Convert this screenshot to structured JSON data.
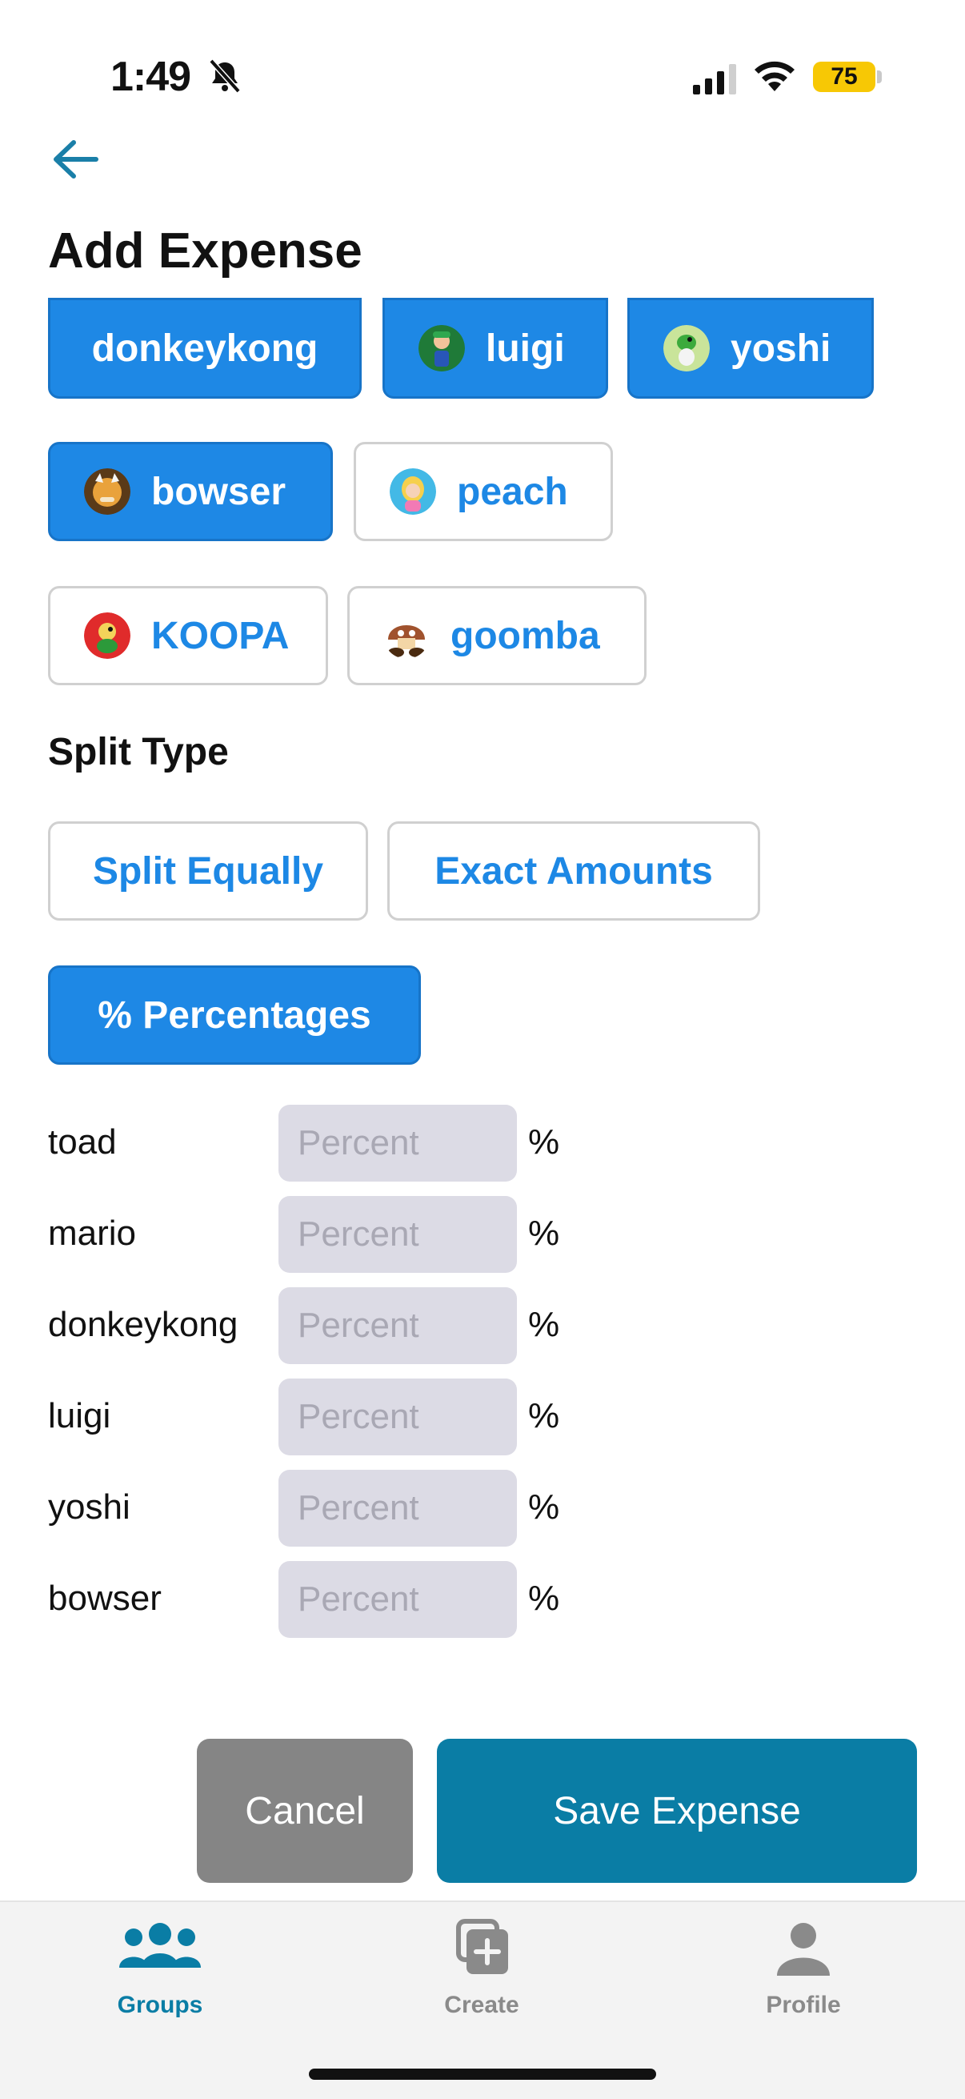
{
  "status_bar": {
    "time": "1:49",
    "battery": "75"
  },
  "header": {
    "title": "Add Expense"
  },
  "participants": [
    {
      "label": "donkeykong",
      "selected": true,
      "avatar": "none"
    },
    {
      "label": "luigi",
      "selected": true,
      "avatar": "luigi-avatar"
    },
    {
      "label": "yoshi",
      "selected": true,
      "avatar": "yoshi-avatar"
    },
    {
      "label": "bowser",
      "selected": true,
      "avatar": "bowser-avatar"
    },
    {
      "label": "peach",
      "selected": false,
      "avatar": "peach-avatar"
    },
    {
      "label": "KOOPA",
      "selected": false,
      "avatar": "koopa-avatar"
    },
    {
      "label": "goomba",
      "selected": false,
      "avatar": "goomba-avatar"
    }
  ],
  "split": {
    "title": "Split Type",
    "options": [
      {
        "label": "Split Equally",
        "selected": false
      },
      {
        "label": "Exact Amounts",
        "selected": false
      },
      {
        "label": "% Percentages",
        "selected": true
      }
    ],
    "rows": [
      {
        "name": "toad",
        "placeholder": "Percent",
        "value": "",
        "unit": "%"
      },
      {
        "name": "mario",
        "placeholder": "Percent",
        "value": "",
        "unit": "%"
      },
      {
        "name": "donkeykong",
        "placeholder": "Percent",
        "value": "",
        "unit": "%"
      },
      {
        "name": "luigi",
        "placeholder": "Percent",
        "value": "",
        "unit": "%"
      },
      {
        "name": "yoshi",
        "placeholder": "Percent",
        "value": "",
        "unit": "%"
      },
      {
        "name": "bowser",
        "placeholder": "Percent",
        "value": "",
        "unit": "%"
      }
    ]
  },
  "actions": {
    "cancel": "Cancel",
    "save": "Save Expense"
  },
  "tabbar": {
    "items": [
      {
        "label": "Groups",
        "icon": "groups-icon",
        "active": true
      },
      {
        "label": "Create",
        "icon": "create-icon",
        "active": false
      },
      {
        "label": "Profile",
        "icon": "profile-icon",
        "active": false
      }
    ]
  },
  "colors": {
    "chip_selected": "#1e88e5",
    "chip_text": "#1d88e5",
    "save_button": "#0a7da5",
    "cancel_button": "#858585",
    "tab_active": "#0a7da5",
    "tab_inactive": "#8a8a8a",
    "input_bg": "#dcdbe5"
  }
}
